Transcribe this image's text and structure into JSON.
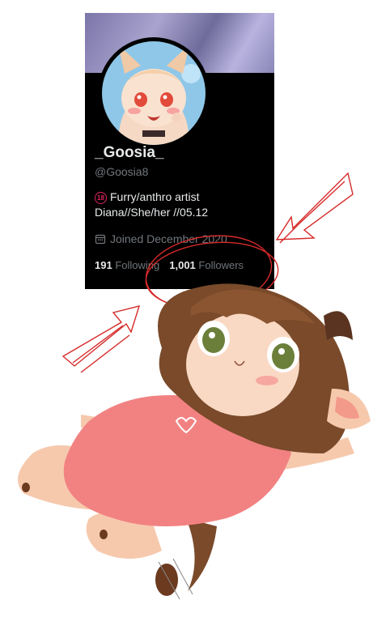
{
  "profile": {
    "display_name": "_Goosia_",
    "handle": "@Goosia8",
    "bio_line1": "Furry/anthro artist",
    "bio_line2": "Diana//She/her //05.12",
    "age_badge": "18",
    "joined": "Joined December 2020",
    "following_count": "191",
    "following_label": "Following",
    "followers_count": "1,001",
    "followers_label": "Followers"
  },
  "icons": {
    "calendar": "calendar-icon",
    "badge": "18-plus-badge-icon"
  },
  "colors": {
    "card_bg": "#000000",
    "text_primary": "#e7e9ea",
    "text_secondary": "#71767b",
    "annotation_red": "#d62a2a",
    "shirt_pink": "#f08080",
    "hair_brown": "#7a4a2a"
  }
}
